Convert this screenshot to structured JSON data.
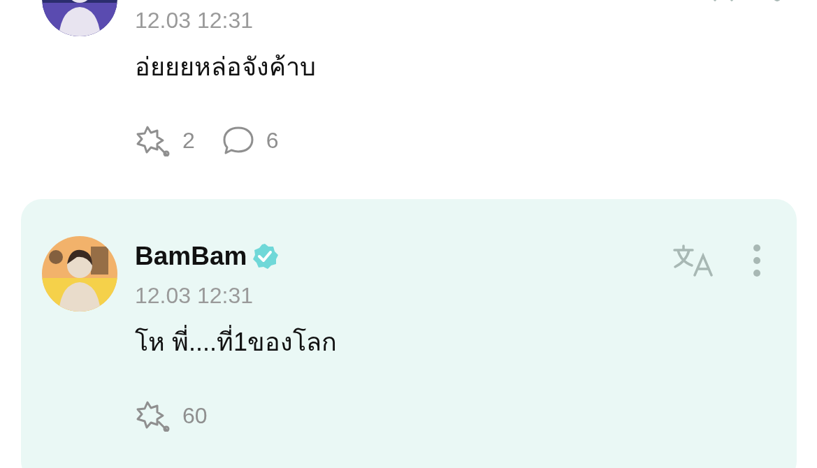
{
  "comments": [
    {
      "time": "12.03 12:31",
      "text": "อ่ยยยหล่อจังค้าบ",
      "highlighted": false,
      "reactions": [
        {
          "kind": "cheer",
          "count": "2"
        },
        {
          "kind": "comment",
          "count": "6"
        }
      ]
    },
    {
      "author": "BamBam",
      "verified": true,
      "time": "12.03 12:31",
      "text": "โห พี่....ที่1ของโลก",
      "highlighted": true,
      "reactions": [
        {
          "kind": "cheer",
          "count": "60"
        }
      ]
    }
  ]
}
